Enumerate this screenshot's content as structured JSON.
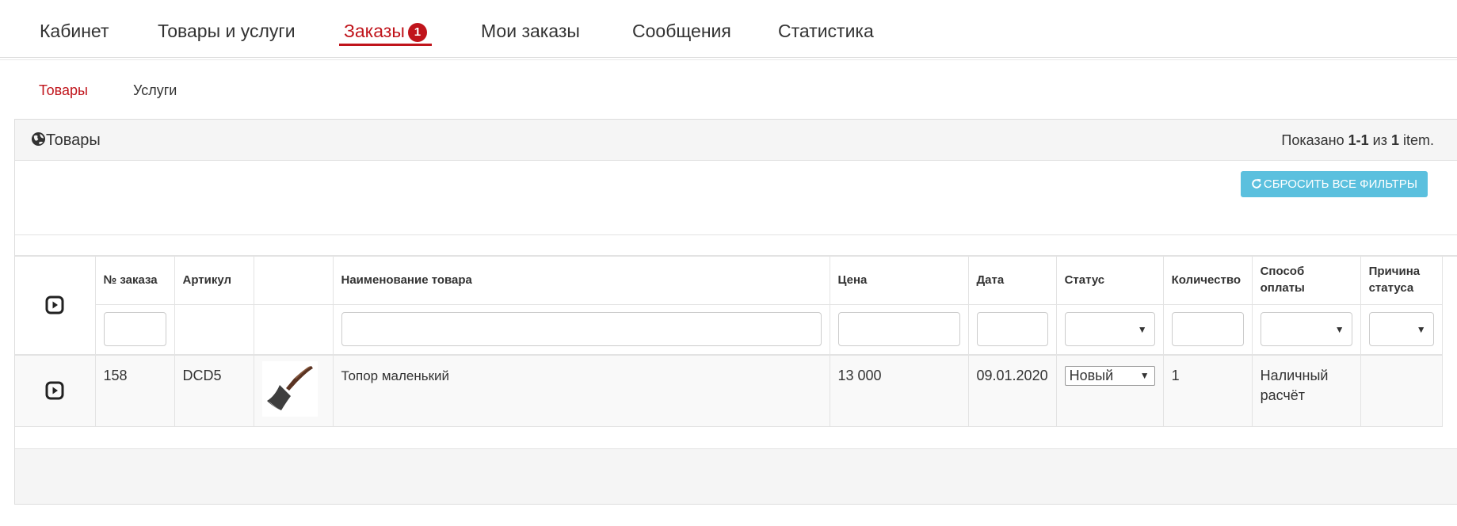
{
  "topnav": {
    "items": [
      {
        "label": "Кабинет"
      },
      {
        "label": "Товары и услуги"
      },
      {
        "label": "Заказы",
        "badge": "1",
        "active": true
      },
      {
        "label": "Мои заказы"
      },
      {
        "label": "Сообщения"
      },
      {
        "label": "Статистика"
      }
    ]
  },
  "subnav": {
    "items": [
      {
        "label": "Товары",
        "active": true
      },
      {
        "label": "Услуги"
      }
    ]
  },
  "panel": {
    "title": "Товары",
    "summary": {
      "prefix": "Показано ",
      "range": "1-1",
      "mid": " из ",
      "total": "1",
      "suffix": " item."
    },
    "reset_label": "СБРОСИТЬ ВСЕ ФИЛЬТРЫ"
  },
  "table": {
    "headers": {
      "order_no": "№ заказа",
      "sku": "Артикул",
      "image": "",
      "name": "Наименование товара",
      "price": "Цена",
      "date": "Дата",
      "status": "Статус",
      "qty": "Количество",
      "payment": "Способ оплаты",
      "reason": "Причина статуса"
    },
    "rows": [
      {
        "order_no": "158",
        "sku": "DCD5",
        "name": "Топор маленький",
        "price": "13 000",
        "date": "09.01.2020",
        "status": "Новый",
        "qty": "1",
        "payment": "Наличный расчёт",
        "reason": ""
      }
    ]
  },
  "colors": {
    "accent": "#c0141b",
    "info": "#5bc0de"
  }
}
